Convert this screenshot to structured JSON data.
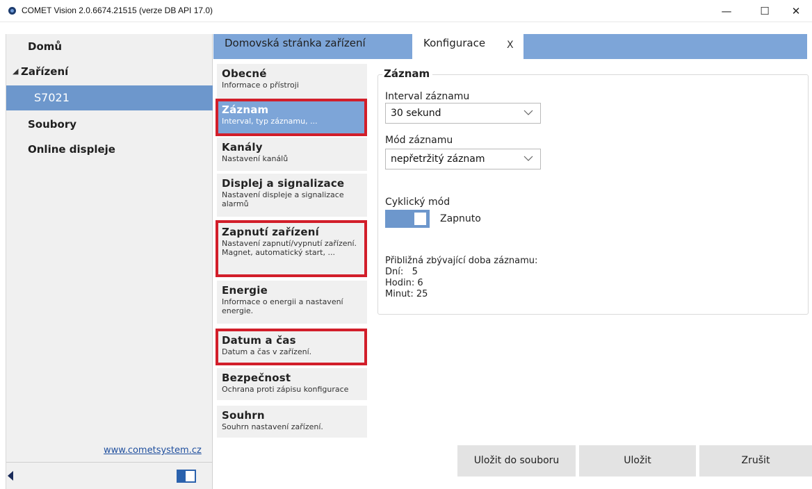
{
  "window": {
    "title": "COMET Vision 2.0.6674.21515 (verze DB API 17.0)",
    "minimize_glyph": "—",
    "maximize_glyph": "☐",
    "close_glyph": "✕"
  },
  "sidebar": {
    "home": "Domů",
    "devices": "Zařízení",
    "device_selected": "S7021",
    "files": "Soubory",
    "online_displays": "Online displeje",
    "link": "www.cometsystem.cz"
  },
  "tabs": {
    "home": "Domovská stránka zařízení",
    "config": "Konfigurace",
    "close": "X"
  },
  "sections": [
    {
      "title": "Obecné",
      "desc": "Informace o přístroji"
    },
    {
      "title": "Záznam",
      "desc": "Interval, typ záznamu, ..."
    },
    {
      "title": "Kanály",
      "desc": "Nastavení kanálů"
    },
    {
      "title": "Displej a signalizace",
      "desc": "Nastavení displeje a signalizace alarmů"
    },
    {
      "title": "Zapnutí zařízení",
      "desc": "Nastavení zapnutí/vypnutí zařízení. Magnet, automatický start, ..."
    },
    {
      "title": "Energie",
      "desc": "Informace o energii a nastavení energie."
    },
    {
      "title": "Datum a čas",
      "desc": "Datum a čas v zařízení."
    },
    {
      "title": "Bezpečnost",
      "desc": "Ochrana proti zápisu konfigurace"
    },
    {
      "title": "Souhrn",
      "desc": "Souhrn nastavení zařízení."
    }
  ],
  "record": {
    "legend": "Záznam",
    "interval_label": "Interval záznamu",
    "interval_value": "30 sekund",
    "mode_label": "Mód záznamu",
    "mode_value": "nepřetržitý záznam",
    "cyclic_label": "Cyklický mód",
    "cyclic_state": "Zapnuto",
    "remaining_label": "Přibližná zbývající doba záznamu:",
    "days": "Dní:   5",
    "hours": "Hodin: 6",
    "minutes": "Minut: 25"
  },
  "buttons": {
    "save_to_file": "Uložit do souboru",
    "save": "Uložit",
    "cancel": "Zrušit"
  },
  "colors": {
    "accent": "#7da5d8",
    "selected": "#6d97cc",
    "highlight_box": "#d21e2a"
  }
}
